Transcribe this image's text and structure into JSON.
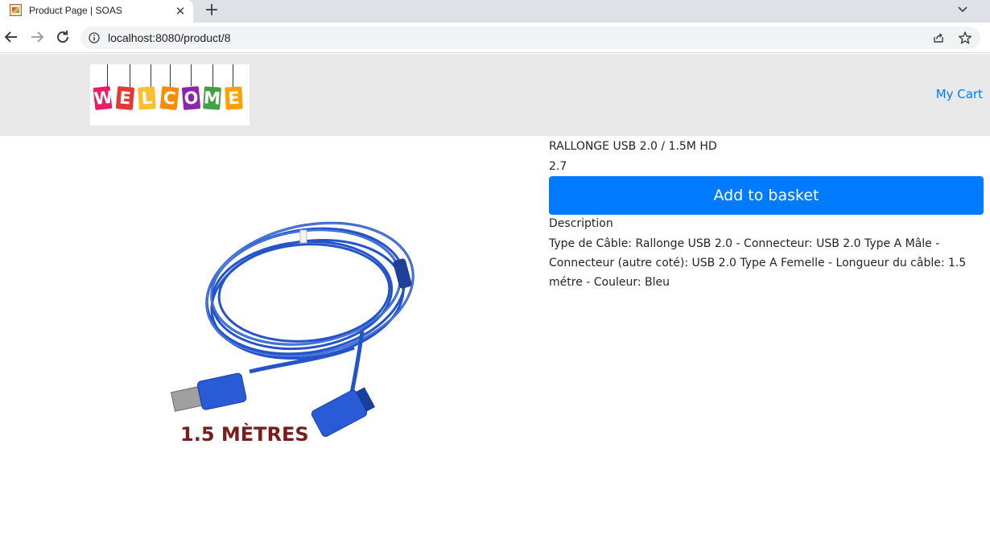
{
  "browser": {
    "tab_title": "Product Page | SOAS",
    "url": "localhost:8080/product/8"
  },
  "header": {
    "logo_text": "WELCOME",
    "cart_label": "My Cart"
  },
  "product": {
    "title": "RALLONGE USB 2.0 / 1.5M HD",
    "price": "2.7",
    "add_button_label": "Add to basket",
    "description_heading": "Description",
    "description": "Type de Câble: Rallonge USB 2.0 - Connecteur: USB 2.0 Type A Mâle - Connecteur (autre coté): USB 2.0 Type A Femelle - Longueur du câble: 1.5 métre - Couleur: Bleu",
    "image_caption": "1.5 MÈTRES"
  },
  "colors": {
    "accent": "#007bff",
    "header_bg": "#e9e9e9",
    "cable_blue": "#2a5bd7"
  }
}
